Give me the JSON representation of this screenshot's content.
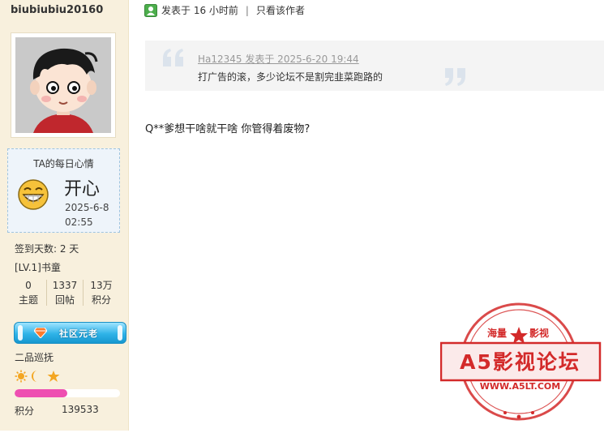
{
  "user": {
    "username": "biubiubiu20160",
    "mood_title": "TA的每日心情",
    "mood": "开心",
    "mood_date": "2025-6-8",
    "mood_time": "02:55",
    "signin_days": "签到天数: 2 天",
    "level": "[LV.1]书童",
    "stats": [
      {
        "value": "0",
        "label": "主题"
      },
      {
        "value": "1337",
        "label": "回帖"
      },
      {
        "value": "13万",
        "label": "积分"
      }
    ],
    "badge_label": "社区元老",
    "rank_title": "二品巡抚",
    "rank_progress": 0.5,
    "points_label": "积分",
    "points_value": "139533",
    "rank_icons": [
      "sun-icon",
      "moon-icon",
      "star-icon"
    ]
  },
  "post": {
    "posted_label": "发表于 16 小时前",
    "only_author": "只看该作者",
    "quote_author": "Ha12345 发表于 2025-6-20 19:44",
    "quote_text": "打广告的滚，多少论坛不是割完韭菜跑路的",
    "body": "Q**爹想干啥就干啥 你管得着废物?"
  },
  "stamp": {
    "top_left": "海量",
    "top_right": "影视",
    "name": "A5影视论坛",
    "url": "WWW.A5LT.COM"
  },
  "colors": {
    "sidebar_bg": "#f8f0dd",
    "quote_bg": "#f4f4f4",
    "progress_fill": "#ee4fb1",
    "stamp_red": "#d32a2a",
    "badge_blue": "#2fb3e8"
  }
}
